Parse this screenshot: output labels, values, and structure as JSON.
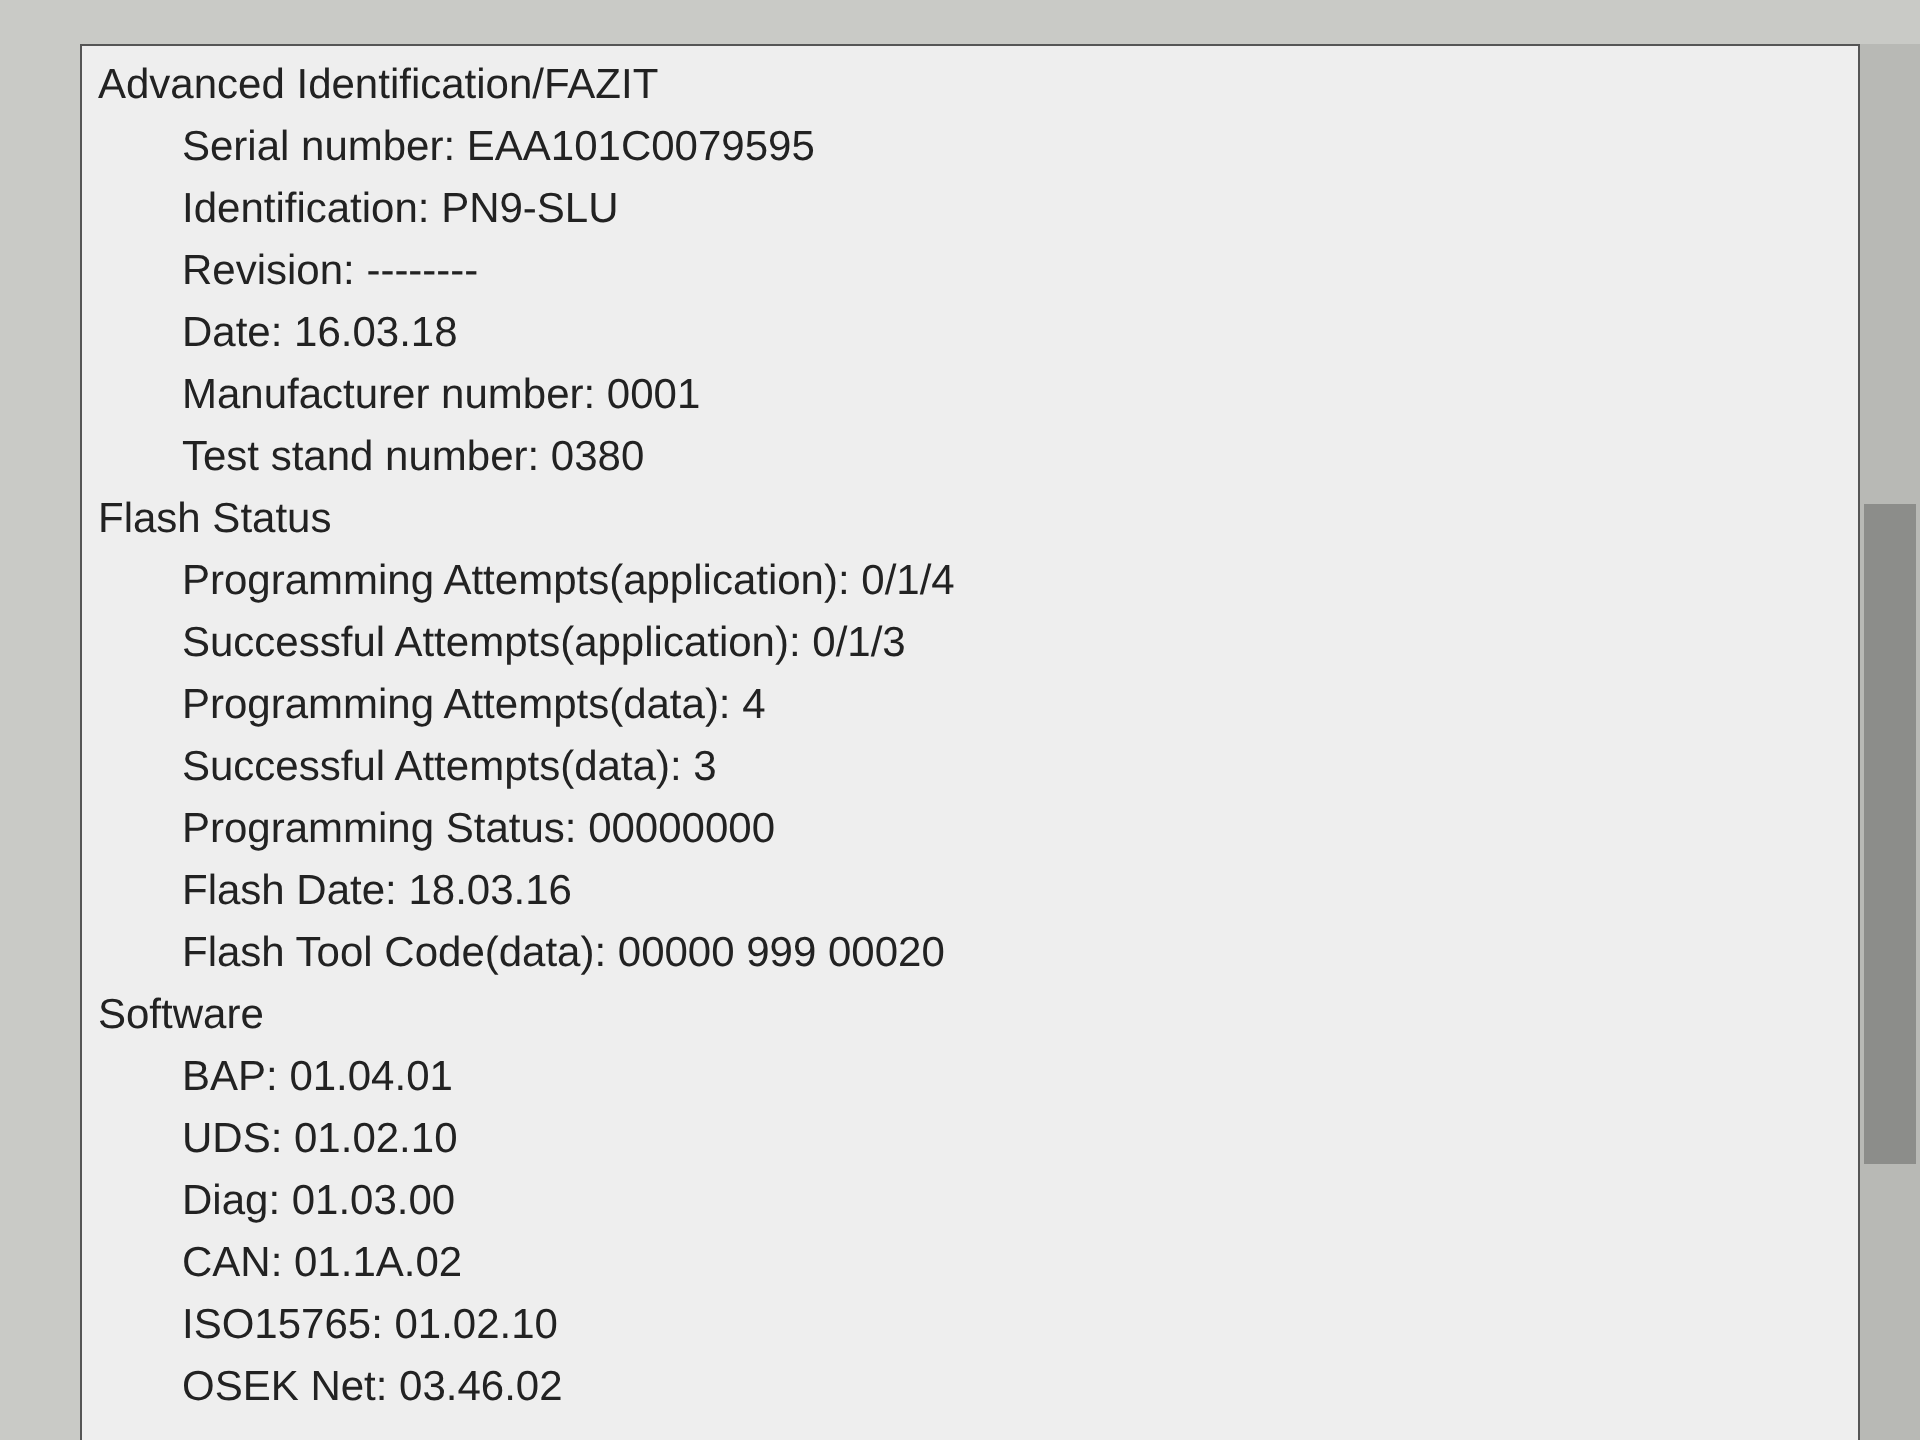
{
  "tree": [
    {
      "label": "Advanced Identification/FAZIT",
      "children": [
        {
          "label": "Serial number: EAA101C0079595"
        },
        {
          "label": "Identification: PN9-SLU"
        },
        {
          "label": "Revision: --------"
        },
        {
          "label": "Date: 16.03.18"
        },
        {
          "label": "Manufacturer number: 0001"
        },
        {
          "label": "Test stand number: 0380"
        }
      ]
    },
    {
      "label": "Flash Status",
      "children": [
        {
          "label": "Programming Attempts(application): 0/1/4"
        },
        {
          "label": "Successful Attempts(application): 0/1/3"
        },
        {
          "label": "Programming Attempts(data): 4"
        },
        {
          "label": "Successful Attempts(data): 3"
        },
        {
          "label": "Programming Status: 00000000"
        },
        {
          "label": "Flash Date: 18.03.16"
        },
        {
          "label": "Flash Tool Code(data): 00000 999 00020"
        }
      ]
    },
    {
      "label": "Software",
      "children": [
        {
          "label": "BAP: 01.04.01"
        },
        {
          "label": "UDS: 01.02.10"
        },
        {
          "label": "Diag: 01.03.00"
        },
        {
          "label": "CAN: 01.1A.02"
        },
        {
          "label": "ISO15765: 01.02.10"
        },
        {
          "label": "OSEK Net: 03.46.02"
        }
      ]
    }
  ]
}
